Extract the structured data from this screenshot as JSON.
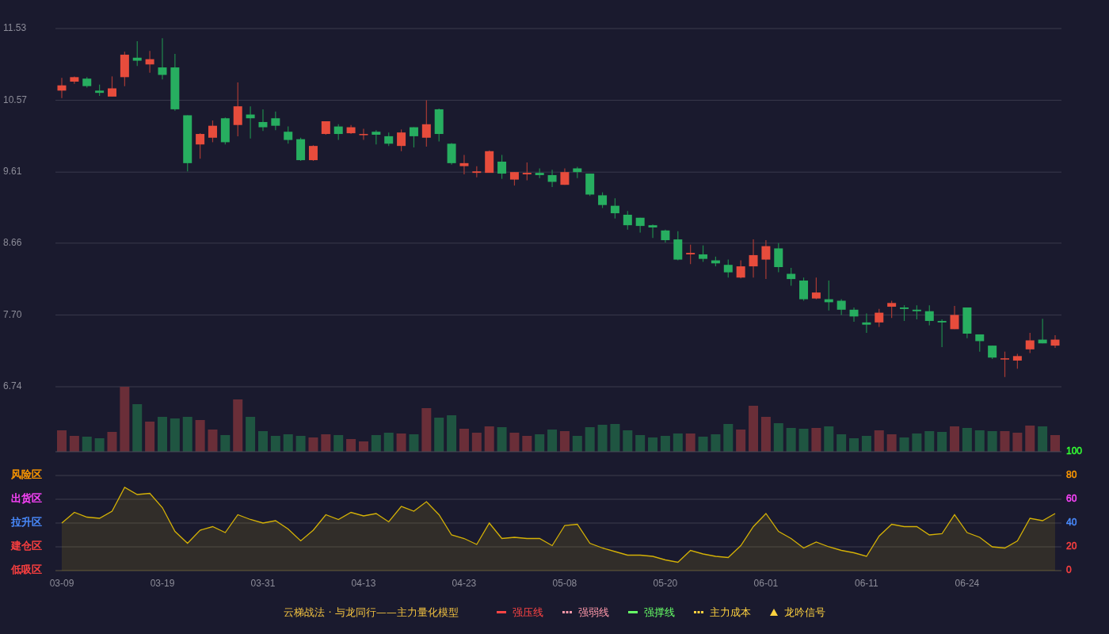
{
  "price_chart": {
    "chart_data": {
      "type": "candlestick",
      "ylim": [
        6.74,
        11.53
      ],
      "grid": true,
      "yticks": [
        {
          "value": 11.53,
          "label": "11.53"
        },
        {
          "value": 10.57,
          "label": "10.57"
        },
        {
          "value": 9.61,
          "label": "9.61"
        },
        {
          "value": 8.66,
          "label": "8.66"
        },
        {
          "value": 7.7,
          "label": "7.70"
        },
        {
          "value": 6.74,
          "label": "6.74"
        }
      ],
      "categories": [
        null,
        null,
        null,
        null,
        null,
        null,
        null,
        null,
        null,
        null,
        null,
        null,
        null,
        null,
        null,
        null,
        null,
        null,
        null,
        null,
        null,
        null,
        null,
        null,
        null,
        null,
        null,
        null,
        null,
        null,
        null,
        null,
        null,
        null,
        null,
        null,
        null,
        null,
        null,
        null,
        null,
        null,
        null,
        null,
        null,
        null,
        null,
        null,
        null,
        null,
        null,
        null,
        null,
        null,
        null,
        null,
        null,
        null,
        null,
        null,
        null,
        null,
        null,
        null,
        null,
        null,
        null,
        null,
        null,
        null,
        null,
        null,
        null,
        null,
        null,
        null,
        null,
        null,
        null,
        null
      ],
      "ohlc": [
        [
          10.7,
          10.87,
          10.6,
          10.77
        ],
        [
          10.82,
          10.89,
          10.79,
          10.88
        ],
        [
          10.86,
          10.88,
          10.74,
          10.76
        ],
        [
          10.7,
          10.78,
          10.63,
          10.67
        ],
        [
          10.62,
          10.89,
          10.62,
          10.73
        ],
        [
          10.88,
          11.22,
          10.76,
          11.18
        ],
        [
          11.14,
          11.36,
          11.03,
          11.1
        ],
        [
          11.05,
          11.23,
          10.94,
          11.12
        ],
        [
          11.01,
          11.4,
          10.85,
          10.91
        ],
        [
          11.01,
          11.19,
          10.43,
          10.45
        ],
        [
          10.37,
          10.37,
          9.62,
          9.73
        ],
        [
          9.98,
          10.13,
          9.79,
          10.12
        ],
        [
          10.07,
          10.3,
          10.01,
          10.23
        ],
        [
          10.33,
          10.34,
          9.98,
          10.01
        ],
        [
          10.24,
          10.81,
          10.09,
          10.49
        ],
        [
          10.38,
          10.49,
          10.06,
          10.33
        ],
        [
          10.28,
          10.45,
          10.16,
          10.21
        ],
        [
          10.33,
          10.42,
          10.17,
          10.23
        ],
        [
          10.15,
          10.22,
          9.99,
          10.04
        ],
        [
          10.05,
          10.07,
          9.76,
          9.77
        ],
        [
          9.77,
          9.97,
          9.76,
          9.96
        ],
        [
          10.12,
          10.29,
          10.11,
          10.29
        ],
        [
          10.22,
          10.25,
          10.04,
          10.12
        ],
        [
          10.13,
          10.24,
          10.12,
          10.21
        ],
        [
          10.11,
          10.19,
          10.04,
          10.12
        ],
        [
          10.15,
          10.17,
          9.98,
          10.11
        ],
        [
          10.09,
          10.14,
          9.96,
          9.99
        ],
        [
          9.96,
          10.18,
          9.89,
          10.14
        ],
        [
          10.21,
          10.21,
          9.94,
          10.09
        ],
        [
          10.07,
          10.57,
          9.95,
          10.25
        ],
        [
          10.45,
          10.46,
          10.02,
          10.12
        ],
        [
          9.99,
          10.0,
          9.71,
          9.73
        ],
        [
          9.69,
          9.84,
          9.58,
          9.73
        ],
        [
          9.6,
          9.69,
          9.54,
          9.62
        ],
        [
          9.6,
          9.9,
          9.6,
          9.89
        ],
        [
          9.75,
          9.84,
          9.52,
          9.59
        ],
        [
          9.51,
          9.61,
          9.43,
          9.61
        ],
        [
          9.58,
          9.74,
          9.5,
          9.6
        ],
        [
          9.6,
          9.66,
          9.53,
          9.57
        ],
        [
          9.57,
          9.64,
          9.41,
          9.48
        ],
        [
          9.44,
          9.66,
          9.44,
          9.61
        ],
        [
          9.66,
          9.68,
          9.53,
          9.61
        ],
        [
          9.59,
          9.59,
          9.29,
          9.31
        ],
        [
          9.3,
          9.34,
          9.13,
          9.17
        ],
        [
          9.16,
          9.26,
          8.99,
          9.06
        ],
        [
          9.04,
          9.09,
          8.84,
          8.9
        ],
        [
          9.0,
          9.0,
          8.8,
          8.89
        ],
        [
          8.9,
          8.91,
          8.73,
          8.87
        ],
        [
          8.83,
          8.84,
          8.67,
          8.7
        ],
        [
          8.71,
          8.82,
          8.43,
          8.44
        ],
        [
          8.51,
          8.64,
          8.38,
          8.53
        ],
        [
          8.51,
          8.63,
          8.41,
          8.45
        ],
        [
          8.43,
          8.48,
          8.35,
          8.39
        ],
        [
          8.37,
          8.44,
          8.2,
          8.27
        ],
        [
          8.2,
          8.43,
          8.19,
          8.35
        ],
        [
          8.35,
          8.71,
          8.2,
          8.5
        ],
        [
          8.44,
          8.7,
          8.18,
          8.62
        ],
        [
          8.59,
          8.66,
          8.27,
          8.34
        ],
        [
          8.25,
          8.33,
          8.09,
          8.18
        ],
        [
          8.16,
          8.2,
          7.89,
          7.91
        ],
        [
          7.92,
          8.2,
          7.91,
          8.0
        ],
        [
          7.91,
          8.16,
          7.76,
          7.87
        ],
        [
          7.89,
          7.91,
          7.7,
          7.77
        ],
        [
          7.77,
          7.8,
          7.61,
          7.68
        ],
        [
          7.6,
          7.72,
          7.46,
          7.57
        ],
        [
          7.6,
          7.78,
          7.54,
          7.73
        ],
        [
          7.81,
          7.89,
          7.66,
          7.86
        ],
        [
          7.8,
          7.83,
          7.62,
          7.78
        ],
        [
          7.77,
          7.83,
          7.64,
          7.75
        ],
        [
          7.75,
          7.83,
          7.56,
          7.62
        ],
        [
          7.62,
          7.64,
          7.27,
          7.6
        ],
        [
          7.51,
          7.82,
          7.51,
          7.7
        ],
        [
          7.8,
          7.8,
          7.39,
          7.45
        ],
        [
          7.44,
          7.44,
          7.21,
          7.35
        ],
        [
          7.29,
          7.29,
          7.11,
          7.13
        ],
        [
          7.11,
          7.21,
          6.87,
          7.12
        ],
        [
          7.09,
          7.18,
          6.98,
          7.15
        ],
        [
          7.24,
          7.46,
          7.19,
          7.36
        ],
        [
          7.37,
          7.65,
          7.32,
          7.32
        ],
        [
          7.29,
          7.43,
          7.26,
          7.37
        ]
      ]
    }
  },
  "oscillator": {
    "zones": [
      {
        "label": "风险区",
        "color": "#ff9900"
      },
      {
        "label": "出货区",
        "color": "#ff44ff"
      },
      {
        "label": "拉升区",
        "color": "#4a8cff"
      },
      {
        "label": "建仓区",
        "color": "#ff4040"
      },
      {
        "label": "低吸区",
        "color": "#ff4040"
      }
    ],
    "axis_labels": [
      {
        "color": "#33ff33"
      },
      {
        "color": "#ff9900"
      },
      {
        "color": "#ff44ff"
      },
      {
        "color": "#4a8cff"
      },
      {
        "color": "#ff4040"
      },
      {
        "color": "#ff4040"
      }
    ],
    "chart_data": {
      "type": "area",
      "ylim": [
        0,
        100
      ],
      "grid": true,
      "yticks": [
        100,
        80,
        60,
        40,
        20,
        0
      ],
      "categories": [
        "03-09",
        null,
        null,
        null,
        null,
        null,
        null,
        null,
        "03-19",
        null,
        null,
        null,
        null,
        null,
        null,
        null,
        "03-31",
        null,
        null,
        null,
        null,
        null,
        null,
        null,
        "04-13",
        null,
        null,
        null,
        null,
        null,
        null,
        null,
        "04-23",
        null,
        null,
        null,
        null,
        null,
        null,
        null,
        "05-08",
        null,
        null,
        null,
        null,
        null,
        null,
        null,
        "05-20",
        null,
        null,
        null,
        null,
        null,
        null,
        null,
        "06-01",
        null,
        null,
        null,
        null,
        null,
        null,
        null,
        "06-11",
        null,
        null,
        null,
        null,
        null,
        null,
        null,
        "06-24",
        null,
        null,
        null,
        null,
        null,
        null,
        null
      ],
      "series": [
        {
          "color": "#d4b106",
          "values": [
            40,
            49,
            45,
            44,
            50,
            70,
            64,
            65,
            53,
            33,
            23,
            34,
            37,
            32,
            47,
            43,
            40,
            42,
            35,
            25,
            34,
            47,
            43,
            49,
            46,
            48,
            41,
            54,
            50,
            58,
            47,
            30,
            27,
            22,
            40,
            27,
            28,
            27,
            27,
            21,
            38,
            39,
            23,
            19,
            16,
            13,
            13,
            12,
            9,
            7,
            17,
            14,
            12,
            11,
            21,
            37,
            48,
            33,
            27,
            19,
            24,
            20,
            17,
            15,
            12,
            29,
            39,
            37,
            37,
            30,
            31,
            47,
            32,
            28,
            20,
            19,
            25,
            44,
            42,
            48
          ]
        }
      ]
    }
  },
  "legend": {
    "title": "云梯战法 · 与龙同行——主力量化模型",
    "items": [
      {
        "kind": "solid",
        "label": "强压线",
        "color": "#ff4444"
      },
      {
        "kind": "dashed",
        "label": "强弱线",
        "color": "#ff99aa"
      },
      {
        "kind": "solid",
        "label": "强撑线",
        "color": "#66ff66"
      },
      {
        "kind": "dashed",
        "label": "主力成本",
        "color": "#ffd23f"
      },
      {
        "kind": "triangle",
        "label": "龙吟信号",
        "color": "#ffd23f"
      }
    ]
  }
}
